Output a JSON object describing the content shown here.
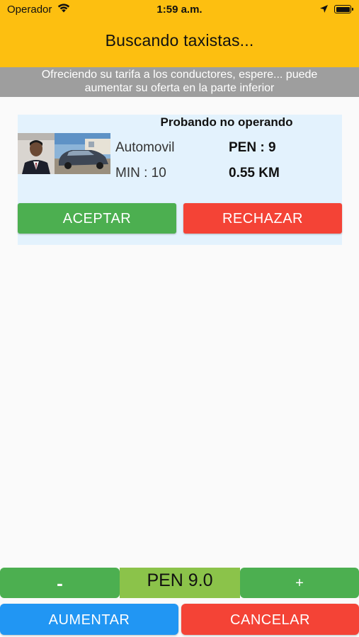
{
  "status_bar": {
    "carrier": "Operador",
    "time": "1:59 a.m."
  },
  "header": {
    "title": "Buscando taxistas..."
  },
  "notice": {
    "line1": "Ofreciendo su tarifa a los conductores, espere... puede",
    "line2": "aumentar su oferta en la parte inferior"
  },
  "offer_card": {
    "driver_name": "Probando no operando",
    "vehicle_type": "Automovil",
    "price": "PEN :  9",
    "minutes": "MIN : 10",
    "distance": "0.55 KM",
    "accept_label": "ACEPTAR",
    "reject_label": "RECHAZAR"
  },
  "fare_controls": {
    "decrease_label": "-",
    "offer_value": "PEN 9.0",
    "increase_step_label": "+",
    "raise_label": "AUMENTAR",
    "cancel_label": "CANCELAR"
  },
  "colors": {
    "header": "#fdbf10",
    "notice": "#9e9e9e",
    "card": "#e3f2fd",
    "green": "#4caf50",
    "light_green": "#8bc34a",
    "red": "#f44336",
    "blue": "#2196f3"
  },
  "icons": [
    "wifi-icon",
    "location-arrow-icon",
    "battery-icon"
  ]
}
